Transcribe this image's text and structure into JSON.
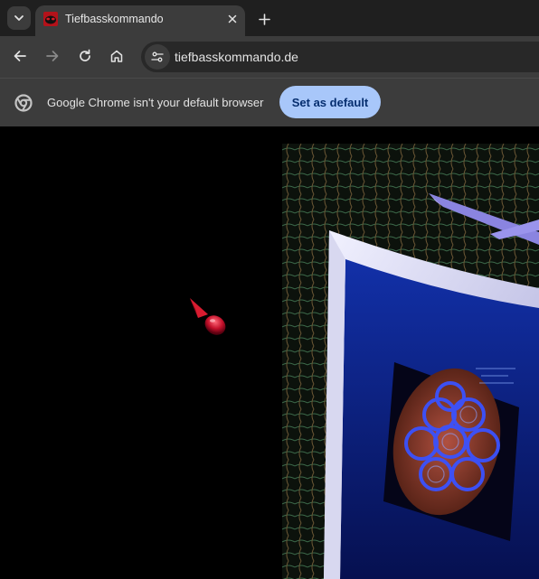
{
  "browser": {
    "tab": {
      "title": "Tiefbasskommando"
    },
    "address_bar": {
      "url": "tiefbasskommando.de"
    },
    "infobar": {
      "message": "Google Chrome isn't your default browser",
      "button_label": "Set as default"
    }
  },
  "colors": {
    "tabstrip": "#1f1f1f",
    "toolbar": "#3c3c3c",
    "omnibox": "#282828",
    "button_accent": "#a8c7fa",
    "page_background": "#000000"
  },
  "icons": [
    "tab-search-icon",
    "favicon-icon",
    "close-icon",
    "plus-icon",
    "back-icon",
    "forward-icon",
    "reload-icon",
    "home-icon",
    "site-info-icon",
    "chrome-logo-icon",
    "cursor-icon"
  ]
}
